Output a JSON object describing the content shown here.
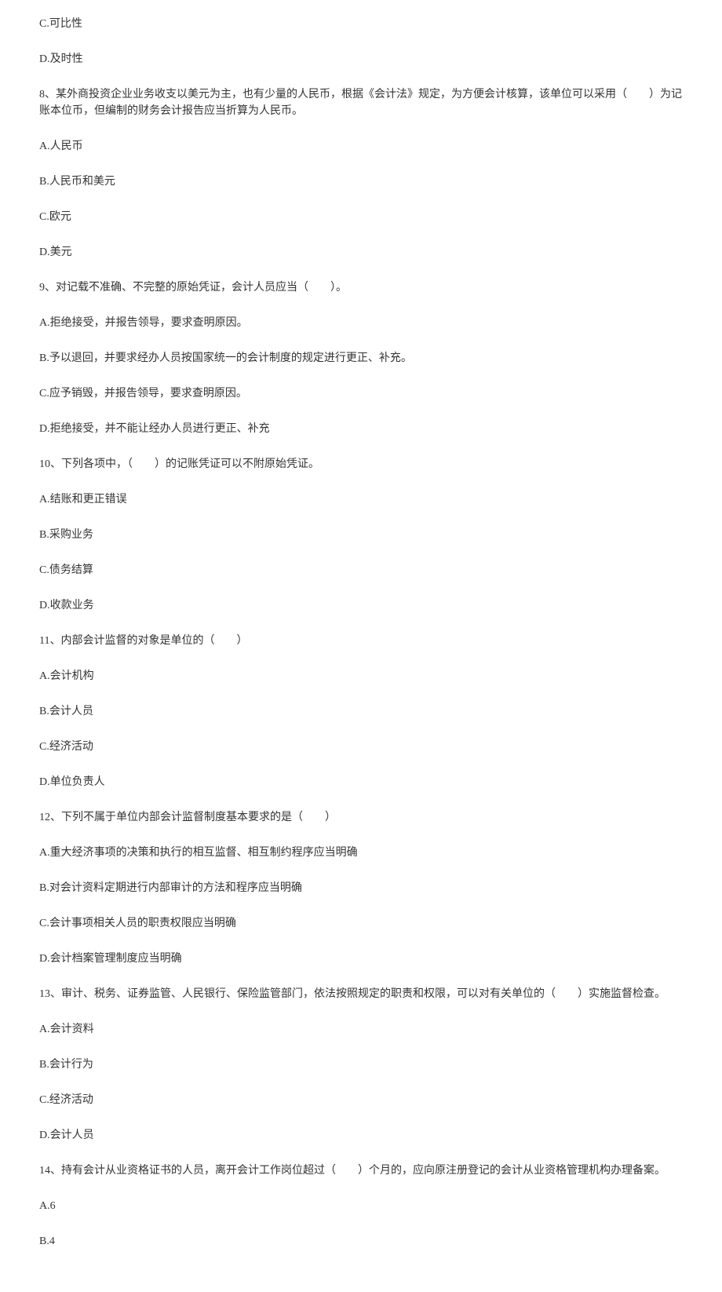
{
  "lines": [
    "C.可比性",
    "D.及时性",
    "8、某外商投资企业业务收支以美元为主，也有少量的人民币，根据《会计法》规定，为方便会计核算，该单位可以采用（　　）为记账本位币，但编制的财务会计报告应当折算为人民币。",
    "A.人民币",
    "B.人民币和美元",
    "C.欧元",
    "D.美元",
    "9、对记载不准确、不完整的原始凭证，会计人员应当（　　）。",
    "A.拒绝接受，并报告领导，要求查明原因。",
    "B.予以退回，并要求经办人员按国家统一的会计制度的规定进行更正、补充。",
    "C.应予销毁，并报告领导，要求查明原因。",
    "D.拒绝接受，并不能让经办人员进行更正、补充",
    "10、下列各项中，（　　）的记账凭证可以不附原始凭证。",
    "A.结账和更正错误",
    "B.采购业务",
    "C.债务结算",
    "D.收款业务",
    "11、内部会计监督的对象是单位的（　　）",
    "A.会计机构",
    "B.会计人员",
    "C.经济活动",
    "D.单位负责人",
    "12、下列不属于单位内部会计监督制度基本要求的是（　　）",
    "A.重大经济事项的决策和执行的相互监督、相互制约程序应当明确",
    "B.对会计资料定期进行内部审计的方法和程序应当明确",
    "C.会计事项相关人员的职责权限应当明确",
    "D.会计档案管理制度应当明确",
    "13、审计、税务、证券监管、人民银行、保险监管部门，依法按照规定的职责和权限，可以对有关单位的（　　）实施监督检查。",
    "A.会计资料",
    "B.会计行为",
    "C.经济活动",
    "D.会计人员",
    "14、持有会计从业资格证书的人员，离开会计工作岗位超过（　　）个月的，应向原注册登记的会计从业资格管理机构办理备案。",
    "A.6",
    "B.4"
  ]
}
